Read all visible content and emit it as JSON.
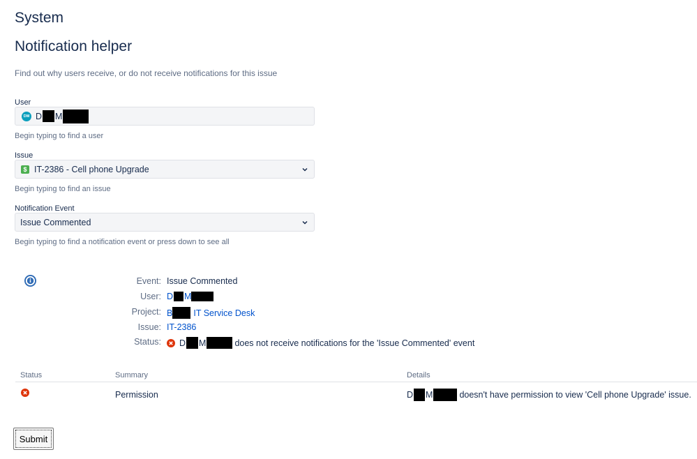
{
  "page": {
    "title": "System",
    "subtitle": "Notification helper",
    "description": "Find out why users receive, or do not receive notifications for this issue"
  },
  "form": {
    "user": {
      "label": "User",
      "avatar_initials": "DM",
      "first_initial": "D",
      "last_initial": "M",
      "hint": "Begin typing to find a user"
    },
    "issue": {
      "label": "Issue",
      "value": "IT-2386 - Cell phone Upgrade",
      "type_icon": "$",
      "hint": "Begin typing to find an issue"
    },
    "event": {
      "label": "Notification Event",
      "value": "Issue Commented",
      "hint": "Begin typing to find a notification event or press down to see all"
    }
  },
  "summary": {
    "event_label": "Event:",
    "event_value": "Issue Commented",
    "user_label": "User:",
    "user_first": "D",
    "user_last": "M",
    "project_label": "Project:",
    "project_prefix": "B",
    "project_suffix": "IT Service Desk",
    "issue_label": "Issue:",
    "issue_value": "IT-2386",
    "status_label": "Status:",
    "status_first": "D",
    "status_last": "M",
    "status_message": "does not receive notifications for the 'Issue Commented' event"
  },
  "table": {
    "headers": [
      "Status",
      "Summary",
      "Details"
    ],
    "rows": [
      {
        "summary": "Permission",
        "details_first": "D",
        "details_last": "M",
        "details_message": "doesn't have permission to view 'Cell phone Upgrade' issue."
      }
    ]
  },
  "submit_label": "Submit",
  "colors": {
    "link": "#0052cc",
    "error": "#de350b",
    "info": "#2f6bb5",
    "avatar": "#0c9fbd",
    "issue_type": "#4caf50"
  }
}
